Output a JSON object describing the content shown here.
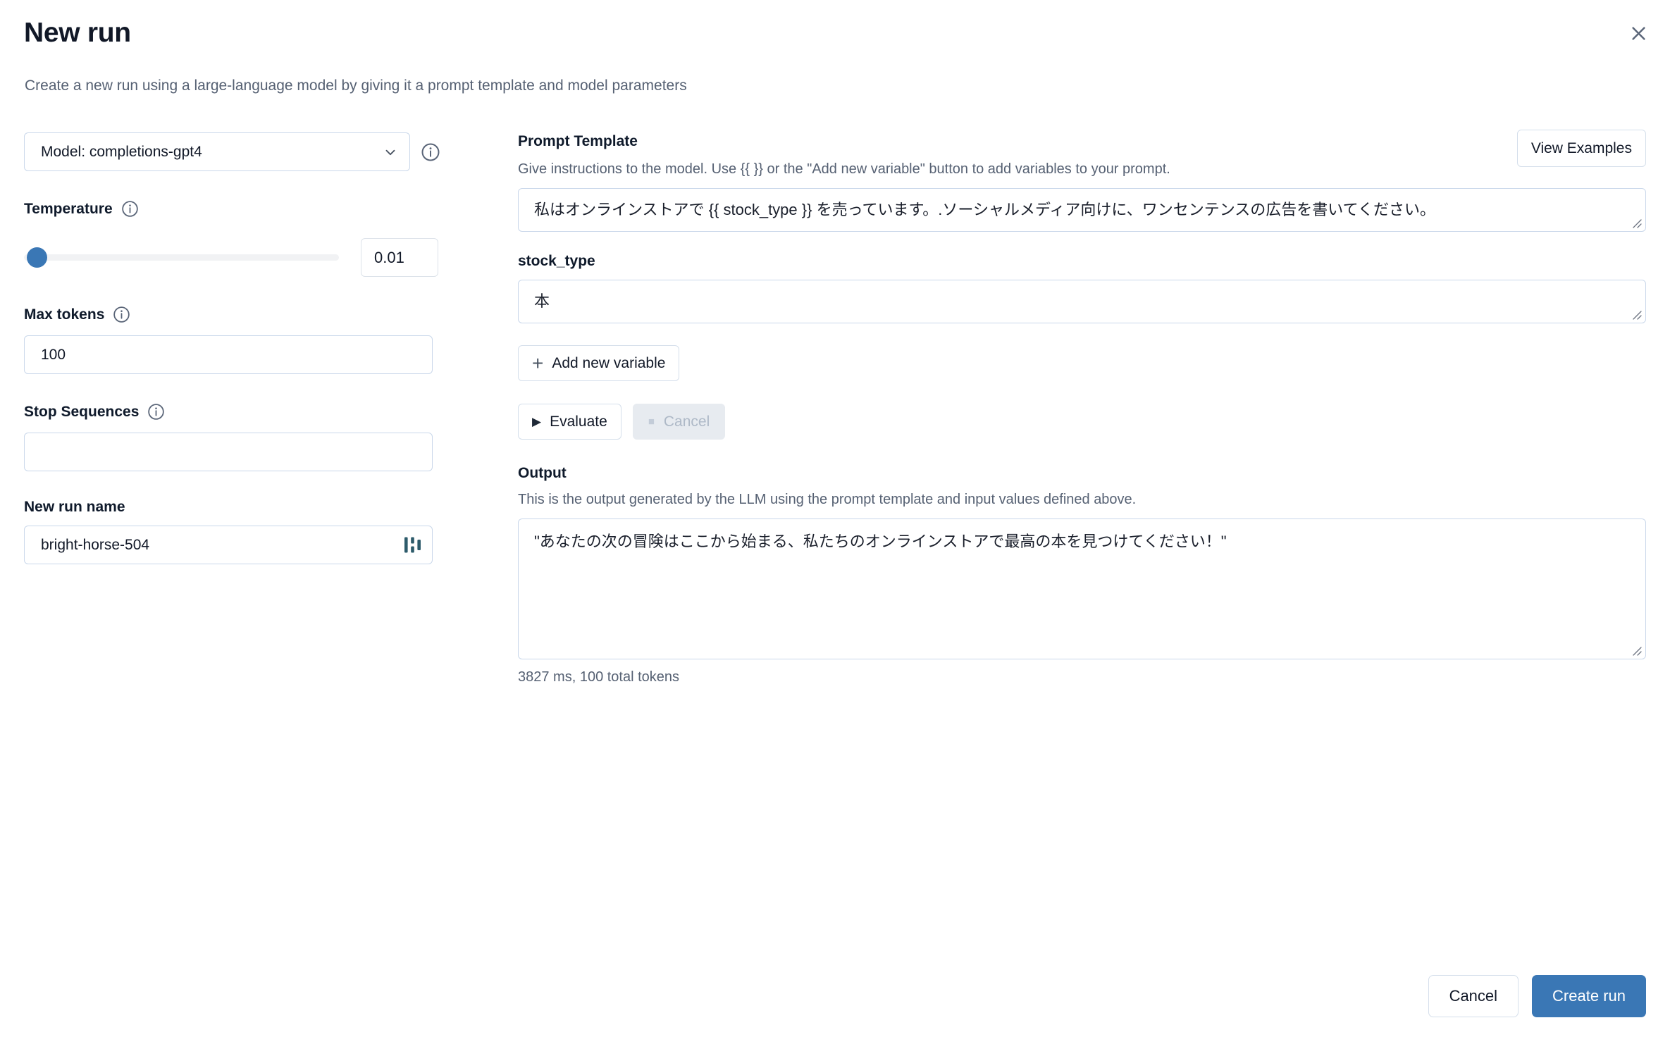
{
  "header": {
    "title": "New run",
    "subtitle": "Create a new run using a large-language model by giving it a prompt template and model parameters",
    "close_icon": "close-icon"
  },
  "left_panel": {
    "model": {
      "selected": "Model: completions-gpt4",
      "chevron_icon": "chevron-down-icon",
      "info_icon": "info-icon"
    },
    "temperature": {
      "label": "Temperature",
      "value": "0.01",
      "slider_percent": 1,
      "info_icon": "info-icon"
    },
    "max_tokens": {
      "label": "Max tokens",
      "value": "100",
      "info_icon": "info-icon"
    },
    "stop_sequences": {
      "label": "Stop Sequences",
      "value": "",
      "placeholder": "",
      "info_icon": "info-icon"
    },
    "new_run_name": {
      "label": "New run name",
      "value": "bright-horse-504",
      "logo_icon": "wandb-logo-icon"
    }
  },
  "right_panel": {
    "prompt_template": {
      "title": "Prompt Template",
      "description": "Give instructions to the model. Use {{ }} or the \"Add new variable\" button to add variables to your prompt.",
      "value": "私はオンラインストアで {{ stock_type }} を売っています。.ソーシャルメディア向けに、ワンセンテンスの広告を書いてください。",
      "view_examples_label": "View Examples"
    },
    "variables": [
      {
        "name": "stock_type",
        "value": "本"
      }
    ],
    "add_variable_label": "Add new variable",
    "evaluate_label": "Evaluate",
    "cancel_label": "Cancel",
    "output": {
      "title": "Output",
      "description": "This is the output generated by the LLM using the prompt template and input values defined above.",
      "value": "\"あなたの次の冒険はここから始まる、私たちのオンラインストアで最高の本を見つけてください！\"",
      "meta": "3827 ms, 100 total tokens"
    }
  },
  "footer": {
    "cancel_label": "Cancel",
    "create_run_label": "Create run"
  },
  "colors": {
    "accent": "#3a77b5",
    "border": "#c9d7ea",
    "muted_text": "#566173",
    "disabled_bg": "#e7ebf0",
    "logo": "#2d5b6b"
  }
}
